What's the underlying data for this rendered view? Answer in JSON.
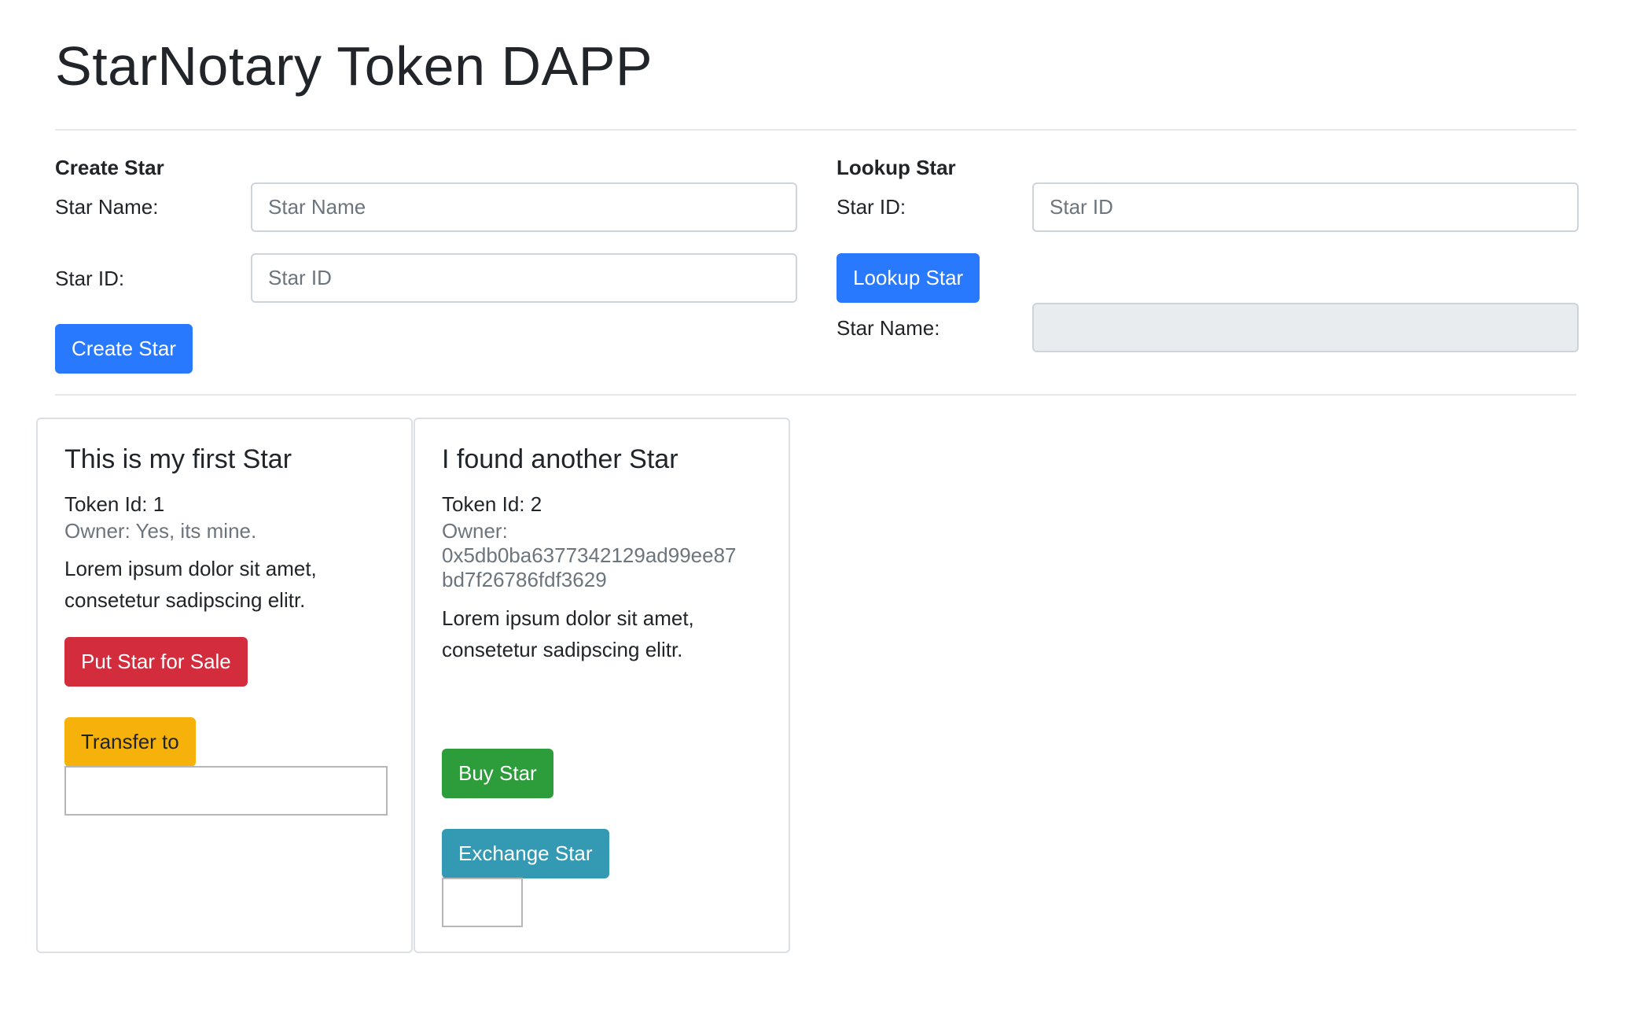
{
  "page": {
    "title": "StarNotary Token DAPP"
  },
  "create_star": {
    "heading": "Create Star",
    "name_label": "Star Name:",
    "name_placeholder": "Star Name",
    "id_label": "Star ID:",
    "id_placeholder": "Star ID",
    "button_label": "Create Star"
  },
  "lookup_star": {
    "heading": "Lookup Star",
    "id_label": "Star ID:",
    "id_placeholder": "Star ID",
    "button_label": "Lookup Star",
    "result_label": "Star Name:",
    "result_value": ""
  },
  "cards": [
    {
      "title": "This is my first Star",
      "token_id": "Token Id: 1",
      "owner": "Owner: Yes, its mine.",
      "description_line1": "Lorem ipsum dolor sit amet,",
      "description_line2": "consetetur sadipscing elitr.",
      "sale_button": "Put Star for Sale",
      "transfer_button": "Transfer to",
      "transfer_value": ""
    },
    {
      "title": "I found another Star",
      "token_id": "Token Id: 2",
      "owner_label": "Owner:",
      "owner_address_line1": "0x5db0ba6377342129ad99ee87",
      "owner_address_line2": "bd7f26786fdf3629",
      "description_line1": "Lorem ipsum dolor sit amet,",
      "description_line2": "consetetur sadipscing elitr.",
      "buy_button": "Buy Star",
      "exchange_button": "Exchange Star",
      "exchange_value": ""
    }
  ],
  "colors": {
    "primary": "#2979ff",
    "danger": "#d22c3d",
    "warning": "#f6b20a",
    "success": "#2d9c3a",
    "info": "#3499b2"
  }
}
